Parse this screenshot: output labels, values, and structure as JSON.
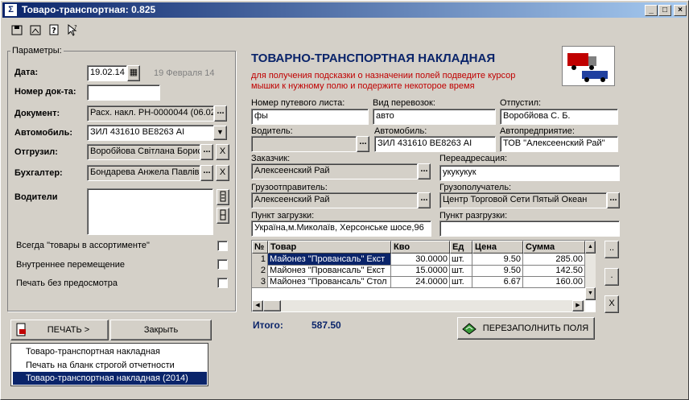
{
  "window": {
    "title": "Товаро-транспортная: 0.825",
    "app_icon": "app-icon",
    "min": "_",
    "max": "□",
    "close": "×"
  },
  "toolbar": [
    "save-icon",
    "save-close-icon",
    "help-icon",
    "pointer-help-icon"
  ],
  "params": {
    "legend": "Параметры:",
    "date_label": "Дата:",
    "date_value": "19.02.14",
    "date_text": "19 Февраля 14",
    "docnum_label": "Номер док-та:",
    "docnum_value": "",
    "document_label": "Документ:",
    "document_value": "Расх. накл. РН-0000044 (06.02",
    "auto_label": "Автомобиль:",
    "auto_value": "ЗИЛ 431610 ВЕ8263 AI",
    "shipped_label": "Отгрузил:",
    "shipped_value": "Воробйова Світлана Борис",
    "acct_label": "Бухгалтер:",
    "acct_value": "Бондарева Анжела Павлів",
    "drivers_label": "Водители",
    "opt1": "Всегда \"товары в ассортименте\"",
    "opt2": "Внутреннее перемещение",
    "opt3": "Печать без предосмотра"
  },
  "buttons": {
    "print": "ПЕЧАТЬ >",
    "close": "Закрыть",
    "refill": "ПЕРЕЗАПОЛНИТЬ ПОЛЯ",
    "dots": "...",
    "x": "X",
    "small_dots": "..",
    "small_dot": "."
  },
  "print_menu": [
    "Товаро-транспортная накладная",
    "Печать на бланк строгой отчетности",
    "Товаро-транспортная накладная (2014)"
  ],
  "form": {
    "title": "ТОВАРНО-ТРАНСПОРТНАЯ НАКЛАДНАЯ",
    "hint": "для получения подсказки о назначении полей подведите курсор мышки к нужному полю и подержите некоторое время",
    "waybill_label": "Номер путевого листа:",
    "waybill_value": "фы",
    "transport_label": "Вид перевозок:",
    "transport_value": "авто",
    "released_label": "Отпустил:",
    "released_value": "Воробйова С. Б.",
    "driver_label": "Водитель:",
    "driver_value": "",
    "car_label": "Автомобиль:",
    "car_value": "ЗИЛ 431610 ВЕ8263 AI",
    "company_label": "Автопредприятие:",
    "company_value": "ТОВ \"Алексеенский Рай\"",
    "customer_label": "Заказчик:",
    "customer_value": "Алексеенский Рай",
    "readdress_label": "Переадресация:",
    "readdress_value": "укукукук",
    "sender_label": "Грузоотправитель:",
    "sender_value": "Алексеенский Рай",
    "receiver_label": "Грузополучатель:",
    "receiver_value": "Центр Торговой Сети Пятый Океан",
    "load_label": "Пункт загрузки:",
    "load_value": "Україна,м.Миколаїв, Херсонське шосе,96",
    "unload_label": "Пункт разгрузки:",
    "unload_value": ""
  },
  "table": {
    "headers": [
      "№",
      "Товар",
      "Кво",
      "Ед",
      "Цена",
      "Сумма"
    ],
    "rows": [
      [
        "1",
        "Майонез \"Провансаль\" Екст",
        "30.0000",
        "шт.",
        "9.50",
        "285.00"
      ],
      [
        "2",
        "Майонез \"Провансаль\" Екст",
        "15.0000",
        "шт.",
        "9.50",
        "142.50"
      ],
      [
        "3",
        "Майонез \"Провансаль\" Стол",
        "24.0000",
        "шт.",
        "6.67",
        "160.00"
      ]
    ]
  },
  "total": {
    "label": "Итого:",
    "value": "587.50"
  },
  "colors": {
    "title_blue": "#0a246a",
    "hint_red": "#c00000",
    "total_blue": "#0a246a"
  }
}
